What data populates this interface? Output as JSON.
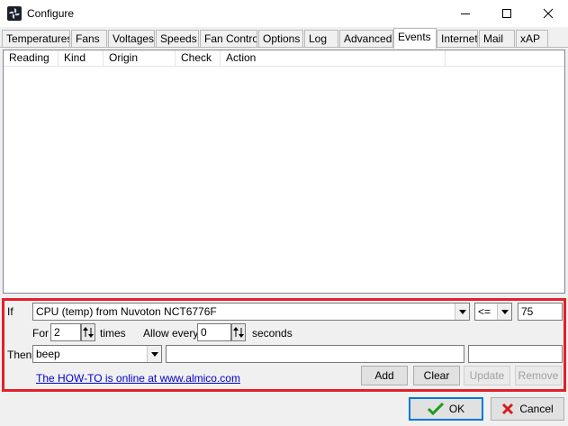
{
  "window": {
    "title": "Configure"
  },
  "tabs": [
    {
      "label": "Temperatures"
    },
    {
      "label": "Fans"
    },
    {
      "label": "Voltages"
    },
    {
      "label": "Speeds"
    },
    {
      "label": "Fan Control"
    },
    {
      "label": "Options"
    },
    {
      "label": "Log"
    },
    {
      "label": "Advanced"
    },
    {
      "label": "Events",
      "active": true
    },
    {
      "label": "Internet"
    },
    {
      "label": "Mail"
    },
    {
      "label": "xAP"
    }
  ],
  "events_table": {
    "columns": [
      "Reading",
      "Kind",
      "Origin",
      "Check",
      "Action"
    ],
    "rows": []
  },
  "event_editor": {
    "if_label": "If",
    "source_value": "CPU (temp) from Nuvoton NCT6776F",
    "operator_value": "<=",
    "threshold_value": "75",
    "for_label": "For",
    "for_value": "2",
    "times_label": "times",
    "allow_every_label": "Allow every",
    "allow_every_value": "0",
    "seconds_label": "seconds",
    "then_label": "Then",
    "action_value": "beep",
    "action_param1": "",
    "action_param2": "",
    "howto_link": "The HOW-TO is online at www.almico.com",
    "add_label": "Add",
    "clear_label": "Clear",
    "update_label": "Update",
    "remove_label": "Remove"
  },
  "footer": {
    "ok_label": "OK",
    "cancel_label": "Cancel"
  },
  "colors": {
    "highlight_border": "#e3202a",
    "link": "#0000cc",
    "ok_check": "#1a9c1a",
    "cancel_x": "#d11f1f"
  }
}
